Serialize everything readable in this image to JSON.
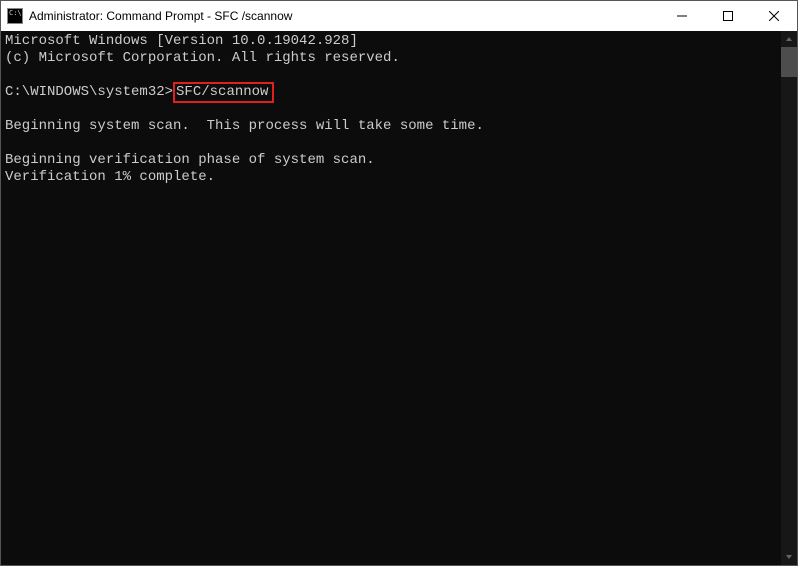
{
  "window": {
    "title": "Administrator: Command Prompt - SFC /scannow",
    "icon_text": "C:\\."
  },
  "terminal": {
    "line1": "Microsoft Windows [Version 10.0.19042.928]",
    "line2": "(c) Microsoft Corporation. All rights reserved.",
    "blank1": "",
    "prompt_prefix": "C:\\WINDOWS\\system32>",
    "command": "SFC/scannow",
    "blank2": "",
    "line4": "Beginning system scan.  This process will take some time.",
    "blank3": "",
    "line5": "Beginning verification phase of system scan.",
    "line6": "Verification 1% complete."
  }
}
